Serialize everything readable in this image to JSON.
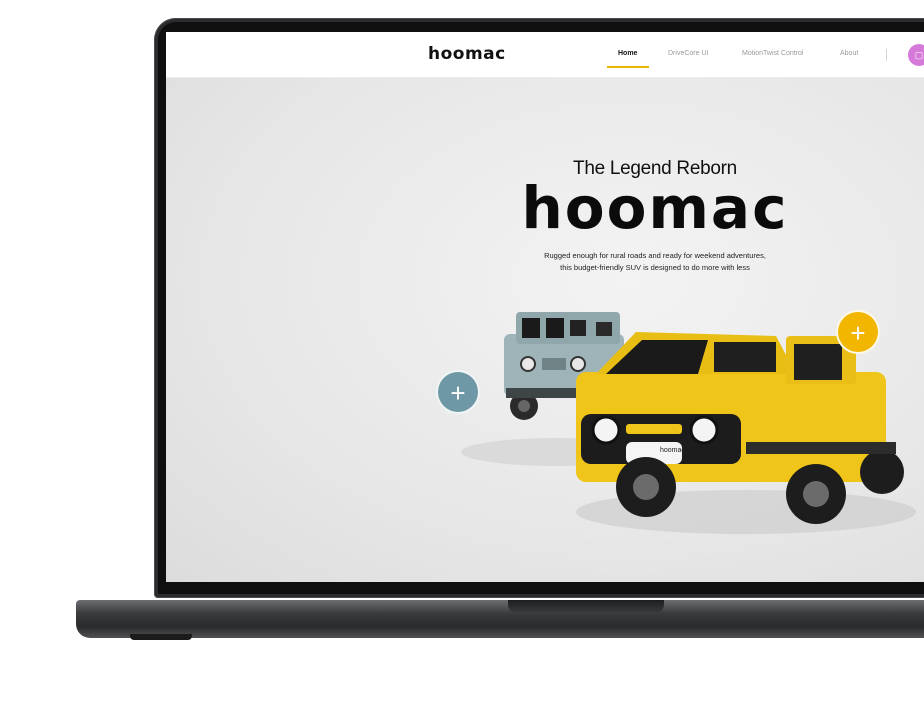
{
  "nav": {
    "brand": "hoomac",
    "items": [
      {
        "label": "Home",
        "active": true
      },
      {
        "label": "DriveCore UI",
        "active": false
      },
      {
        "label": "MotionTwist Control",
        "active": false
      },
      {
        "label": "About",
        "active": false
      }
    ]
  },
  "hero": {
    "tagline": "The Legend Reborn",
    "logo": "hoomac",
    "description_line1": "Rugged enough for rural roads and ready for weekend adventures,",
    "description_line2": "this budget-friendly SUV is designed to do more with less"
  },
  "car_badge": "hoomac",
  "hotspots": [
    {
      "icon": "plus-icon",
      "color": "#6e98a5"
    },
    {
      "icon": "plus-icon",
      "color": "#f2b600"
    }
  ],
  "colors": {
    "accent": "#e7b400",
    "car_yellow": "#f0c51a",
    "car_blue": "#9fb4b8",
    "avatar": "#d57ad8"
  }
}
